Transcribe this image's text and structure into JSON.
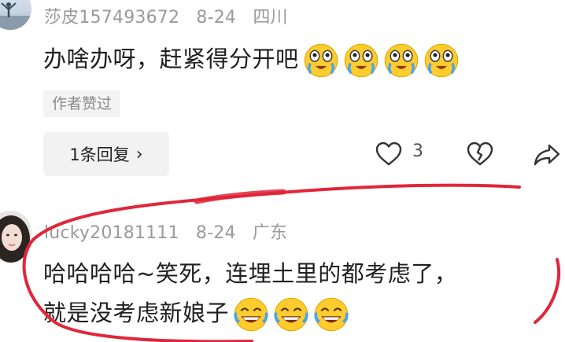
{
  "comment1": {
    "username": "莎皮157493672",
    "date": "8-24",
    "location": "四川",
    "text": "办啥办呀，赶紧得分开吧",
    "emoji_count": 4,
    "emoji_name": "crying-laughing-emoji",
    "author_badge": "作者赞过",
    "reply_button": "1条回复",
    "reply_chevron": "›",
    "like_count": "3"
  },
  "comment2": {
    "username": "lucky20181111",
    "date": "8-24",
    "location": "广东",
    "text_line1": "哈哈哈哈~笑死，连埋土里的都考虑了，",
    "text_line2": "就是没考虑新娘子",
    "emoji_count": 3,
    "emoji_name": "tears-of-joy-emoji"
  },
  "colors": {
    "annotation_stroke": "#e0263a",
    "meta_text": "#9a9a9a",
    "emoji_face": "#ffcc2e",
    "emoji_tear": "#4aa3f0"
  }
}
